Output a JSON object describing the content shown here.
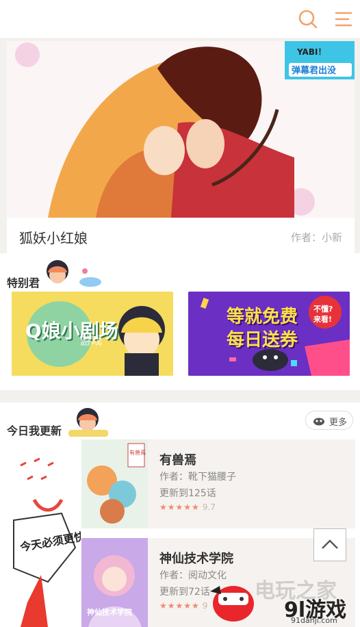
{
  "header": {
    "search_icon": "search-icon",
    "menu_icon": "menu-icon",
    "accent": "#f0a36a"
  },
  "banner": {
    "title": "狐妖小红娘",
    "author": "作者：小新",
    "badge_top": "YABI！",
    "badge_bottom": "弹幕君出没"
  },
  "special": {
    "title": "特别君",
    "promos": [
      {
        "text": "Q娘小剧场",
        "watermark": "游戏"
      },
      {
        "text_line1": "等就免费",
        "text_line2": "每日送券",
        "tag_line1": "不懂?",
        "tag_line2": "来看!"
      }
    ]
  },
  "today": {
    "title": "今日我更新",
    "more_label": "更多",
    "side_text": "今天必须更快画"
  },
  "comics": [
    {
      "title": "有兽焉",
      "author": "作者：靴下猫腰子",
      "update": "更新到125话",
      "stars": "★★★★★",
      "score": "9.7",
      "cover_text": "有兽焉"
    },
    {
      "title": "神仙技术学院",
      "author": "作者：阅动文化",
      "update": "更新到72话",
      "stars": "★★★★★",
      "score": "9",
      "cover_text": "神仙技术学院"
    }
  ],
  "watermark": {
    "brand_faint": "电玩之家",
    "brand": "9l游戏",
    "url": "91danji.com"
  }
}
